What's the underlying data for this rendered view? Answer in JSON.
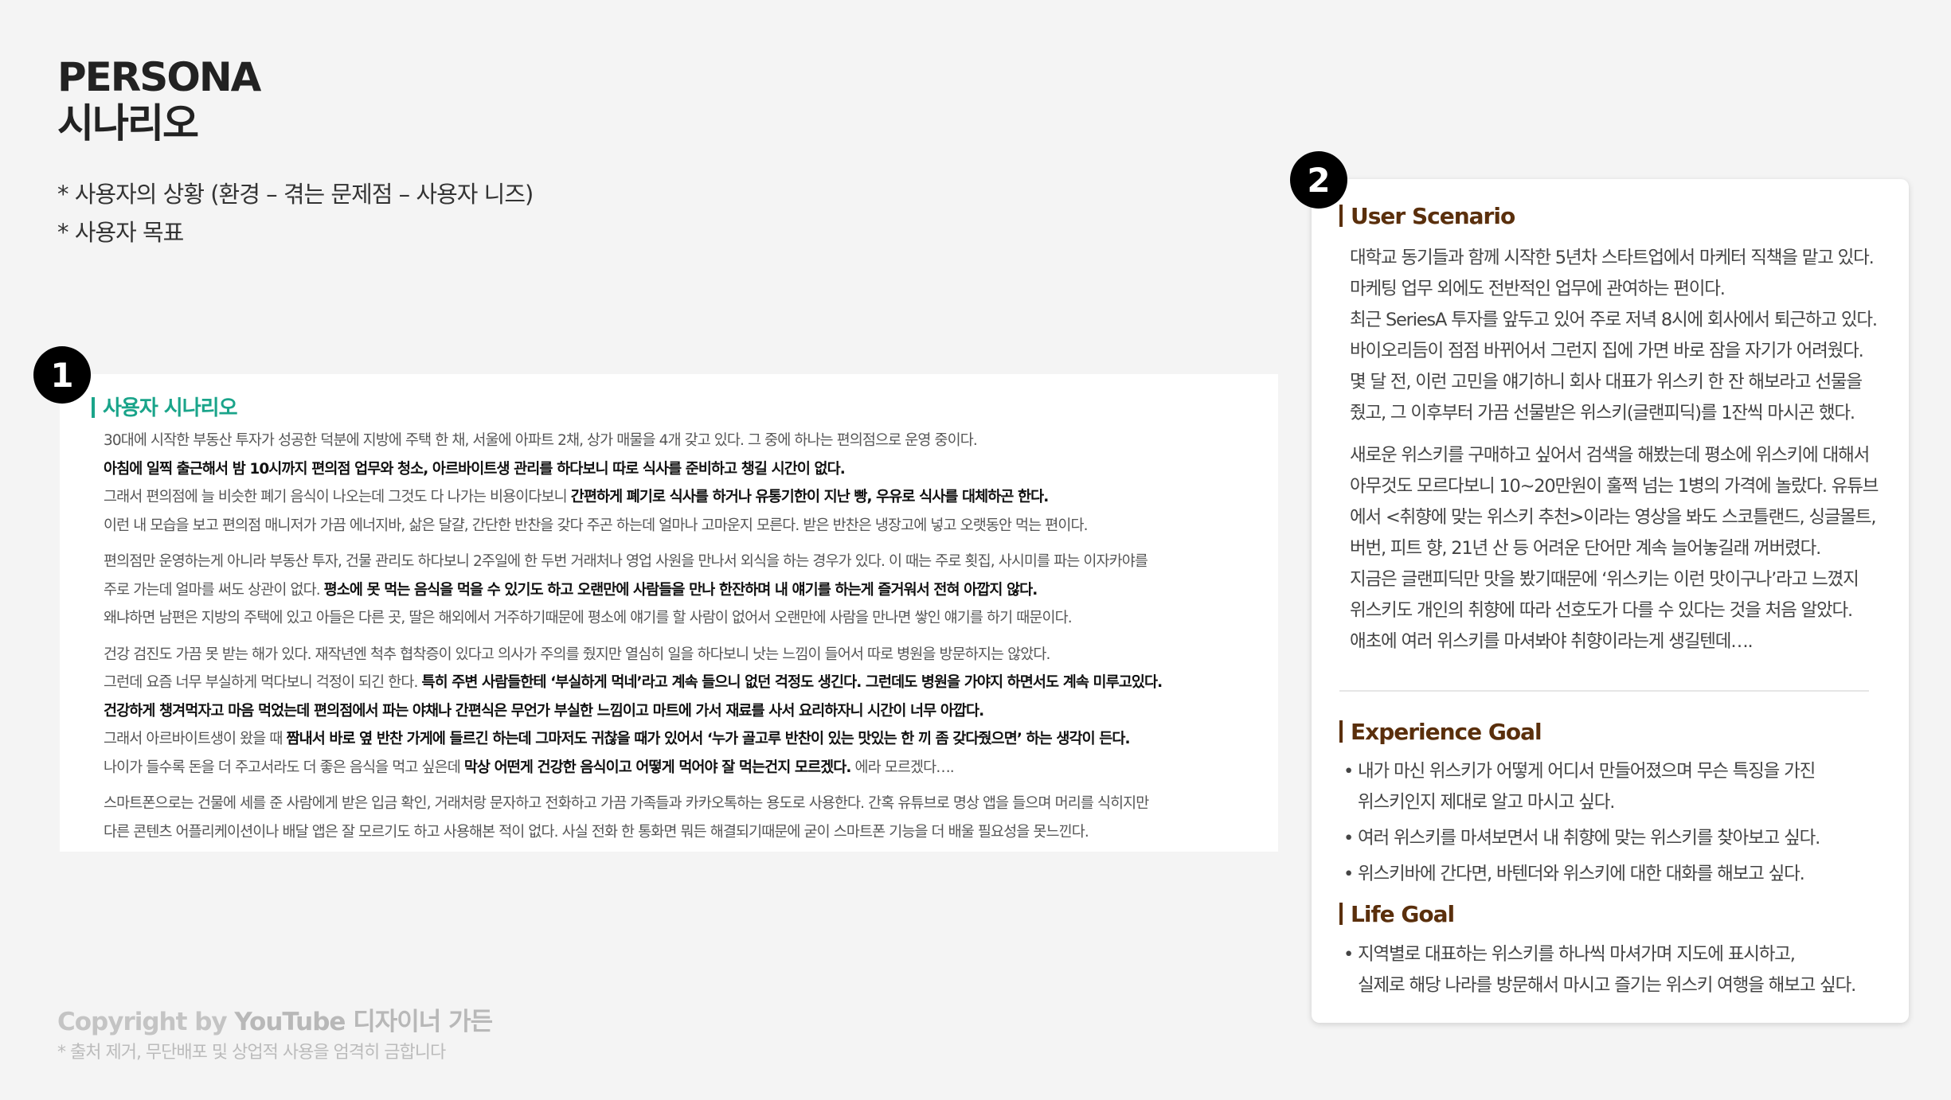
{
  "header": {
    "title_line1": "PERSONA",
    "title_line2": "시나리오",
    "note1": "* 사용자의 상황 (환경 – 겪는 문제점 – 사용자 니즈)",
    "note2": "* 사용자 목표"
  },
  "badges": {
    "one": "1",
    "two": "2"
  },
  "scenario": {
    "heading": "사용자 시나리오",
    "p1": [
      {
        "t": "30대에 시작한 부동산 투자가 성공한 덕분에 지방에 주택 한 채, 서울에 아파트 2채, 상가 매물을 4개 갖고 있다. 그 중에 하나는 편의점으로 운영 중이다."
      },
      {
        "b": "아침에 일찍 출근해서 밤 10시까지 편의점 업무와 청소, 아르바이트생 관리를 하다보니 따로 식사를 준비하고 챙길 시간이 없다."
      },
      {
        "t": "그래서 편의점에 늘 비슷한 폐기 음식이 나오는데 그것도 다 나가는 비용이다보니 ",
        "b": "간편하게 폐기로 식사를 하거나 유통기한이 지난 빵, 우유로 식사를 대체하곤 한다."
      },
      {
        "t": "이런 내 모습을 보고 편의점 매니저가 가끔 에너지바, 삶은 달걀, 간단한 반찬을 갖다 주곤 하는데 얼마나 고마운지 모른다. 받은 반찬은 냉장고에 넣고 오랫동안 먹는 편이다."
      }
    ],
    "p2": [
      {
        "t": "편의점만 운영하는게 아니라 부동산 투자, 건물 관리도 하다보니 2주일에 한 두번 거래처나 영업 사원을 만나서 외식을 하는 경우가 있다. 이 때는 주로 횟집, 사시미를 파는 이자카야를"
      },
      {
        "t": "주로 가는데 얼마를 써도 상관이 없다. ",
        "b": "평소에 못 먹는 음식을 먹을 수 있기도 하고 오랜만에 사람들을 만나 한잔하며 내 얘기를 하는게 즐거워서 전혀 아깝지 않다."
      },
      {
        "t": "왜냐하면 남편은 지방의 주택에 있고 아들은 다른 곳, 딸은 해외에서 거주하기때문에 평소에 얘기를 할 사람이 없어서 오랜만에 사람을 만나면 쌓인 얘기를 하기 때문이다."
      }
    ],
    "p3": [
      {
        "t": "건강 검진도 가끔 못 받는 해가 있다. 재작년엔 척추 협착증이 있다고 의사가 주의를 줬지만 열심히 일을 하다보니 낫는 느낌이 들어서 따로 병원을 방문하지는 않았다."
      },
      {
        "t": "그런데 요즘 너무 부실하게 먹다보니 걱정이 되긴 한다. ",
        "b": "특히 주변 사람들한테 ‘부실하게 먹네’라고 계속 들으니 없던 걱정도 생긴다. 그런데도 병원을 가야지 하면서도 계속 미루고있다."
      },
      {
        "b": "건강하게 챙겨먹자고 마음 먹었는데 편의점에서 파는 야채나 간편식은 무언가 부실한 느낌이고 마트에 가서 재료를 사서 요리하자니 시간이 너무 아깝다."
      },
      {
        "t": "그래서 아르바이트생이 왔을 때 ",
        "b": "짬내서 바로 옆 반찬 가게에 들르긴 하는데 그마저도 귀찮을 때가 있어서 ‘누가 골고루 반찬이 있는 맛있는 한 끼 좀 갖다줬으면’ 하는 생각이 든다."
      },
      {
        "t": "나이가 들수록 돈을 더 주고서라도 더 좋은 음식을 먹고 싶은데 ",
        "b": "막상 어떤게 건강한 음식이고 어떻게 먹어야 잘 먹는건지 모르겠다.",
        "t2": " 에라 모르겠다…."
      }
    ],
    "p4": [
      {
        "t": "스마트폰으로는 건물에 세를 준 사람에게 받은 입금 확인, 거래처랑 문자하고 전화하고 가끔 가족들과 카카오톡하는 용도로 사용한다. 간혹 유튜브로 명상 앱을 들으며 머리를 식히지만"
      },
      {
        "t": "다른 콘텐츠 어플리케이션이나 배달 앱은 잘 모르기도 하고 사용해본 적이 없다. 사실 전화 한 통화면 뭐든 해결되기때문에 굳이 스마트폰 기능을 더 배울 필요성을 못느낀다."
      }
    ]
  },
  "user_scenario": {
    "heading": "User Scenario",
    "p1": [
      "대학교 동기들과 함께 시작한 5년차 스타트업에서 마케터 직책을 맡고 있다.",
      "마케팅 업무 외에도 전반적인 업무에 관여하는 편이다.",
      "최근 SeriesA 투자를 앞두고 있어 주로 저녁 8시에 회사에서 퇴근하고 있다.",
      "바이오리듬이 점점 바뀌어서 그런지 집에 가면 바로 잠을 자기가 어려웠다.",
      "몇 달 전, 이런 고민을 얘기하니 회사 대표가 위스키 한 잔 해보라고 선물을",
      "줬고, 그 이후부터 가끔 선물받은 위스키(글랜피딕)를 1잔씩 마시곤 했다."
    ],
    "p2": [
      "새로운 위스키를 구매하고 싶어서 검색을 해봤는데 평소에 위스키에 대해서",
      "아무것도 모르다보니 10~20만원이 훌쩍 넘는 1병의 가격에 놀랐다. 유튜브",
      "에서 <취향에 맞는 위스키 추천>이라는 영상을 봐도 스코틀랜드, 싱글몰트,",
      "버번, 피트 향, 21년 산 등 어려운 단어만 계속 늘어놓길래 꺼버렸다.",
      "지금은 글랜피딕만 맛을 봤기때문에 ‘위스키는 이런 맛이구나’라고 느꼈지",
      "위스키도 개인의 취향에 따라 선호도가 다를 수 있다는 것을 처음 알았다.",
      "애초에 여러 위스키를 마셔봐야 취향이라는게 생길텐데…."
    ]
  },
  "experience_goal": {
    "heading": "Experience Goal",
    "items": [
      {
        "l1": "내가 마신 위스키가 어떻게 어디서 만들어졌으며 무슨 특징을 가진",
        "l2": "위스키인지 제대로 알고 마시고 싶다."
      },
      {
        "l1": "여러 위스키를 마셔보면서 내 취향에 맞는 위스키를 찾아보고 싶다.",
        "l2": ""
      },
      {
        "l1": "위스키바에 간다면, 바텐더와 위스키에 대한 대화를 해보고 싶다.",
        "l2": ""
      }
    ]
  },
  "life_goal": {
    "heading": "Life Goal",
    "items": [
      {
        "l1": "지역별로 대표하는 위스키를 하나씩 마셔가며 지도에 표시하고,",
        "l2": "실제로 해당 나라를 방문해서 마시고 즐기는 위스키 여행을 해보고 싶다."
      }
    ]
  },
  "footer": {
    "copyright_prefix": "Copyright by ",
    "copyright_brand": "YouTube 디자이너 가든",
    "footnote": "* 출처 제거, 무단배포 및 상업적 사용을 엄격히 금합니다"
  }
}
